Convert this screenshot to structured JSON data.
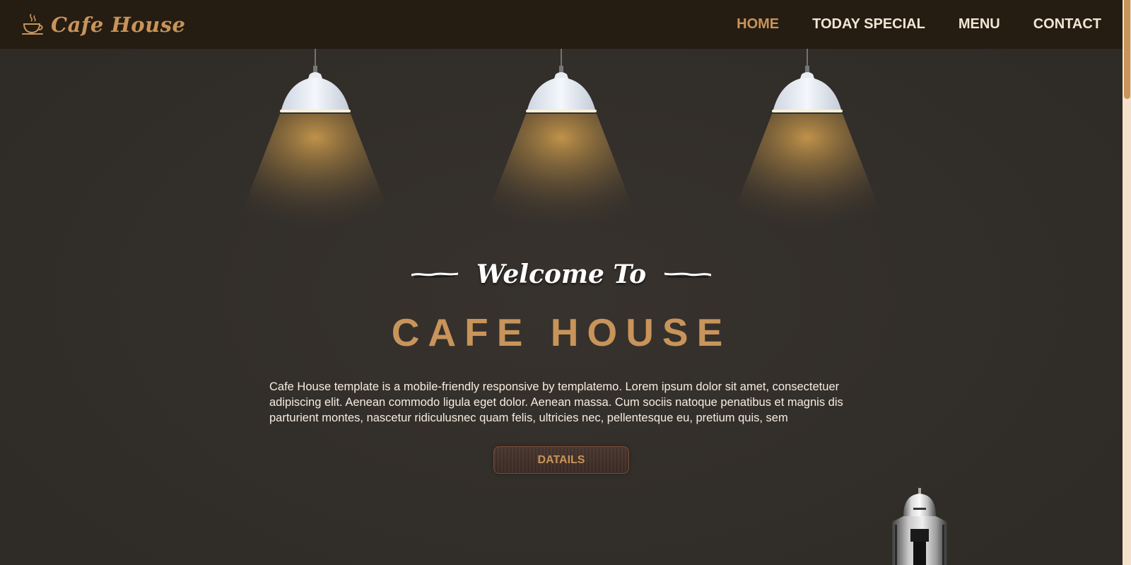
{
  "brand": {
    "name": "Cafe House",
    "icon": "coffee-cup-icon",
    "color": "#c8945a"
  },
  "nav": {
    "items": [
      {
        "label": "HOME",
        "active": true
      },
      {
        "label": "TODAY SPECIAL",
        "active": false
      },
      {
        "label": "MENU",
        "active": false
      },
      {
        "label": "CONTACT",
        "active": false
      }
    ]
  },
  "hero": {
    "welcome": "Welcome To",
    "title": "CAFE HOUSE",
    "description": "Cafe House template is a mobile-friendly responsive by templatemo. Lorem ipsum dolor sit amet, consectetuer adipiscing elit. Aenean commodo ligula eget dolor. Aenean massa. Cum sociis natoque penatibus et magnis dis parturient montes, nascetur ridiculusnec quam felis, ultricies nec, pellentesque eu, pretium quis, sem",
    "button_label": "DATAILS"
  },
  "colors": {
    "accent": "#c8945a",
    "navbar_bg": "#251c12",
    "page_bg": "#34302c",
    "text_light": "#f6ede0"
  }
}
